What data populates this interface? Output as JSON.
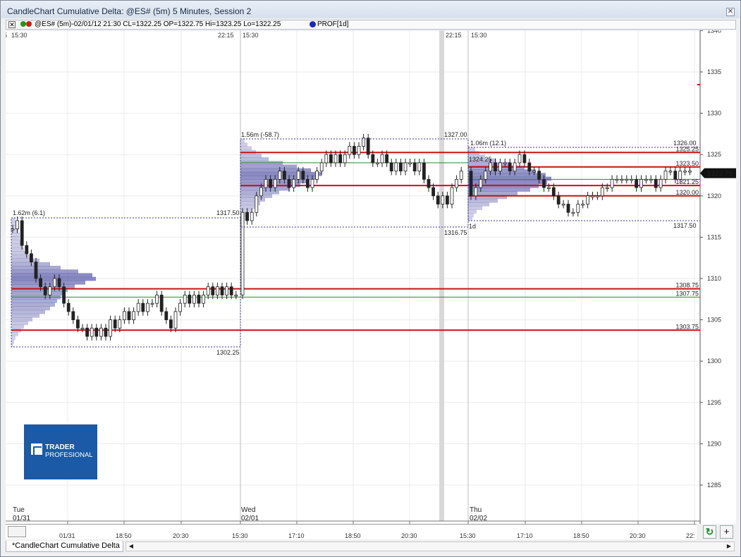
{
  "window": {
    "title": "CandleChart Cumulative Delta: @ES# (5m) 5 Minutes, Session 2",
    "close_glyph": "✕"
  },
  "infobar": {
    "text": "@ES# (5m)-02/01/12 21:30 CL=1322.25 OP=1322.75 Hi=1323.25 Lo=1322.25",
    "study": "PROF[1d]",
    "close_glyph": "✕"
  },
  "price_axis": {
    "ticks": [
      "1340",
      "1335",
      "1330",
      "1325",
      "1320",
      "1315",
      "1310",
      "1305",
      "1300",
      "1295",
      "1290",
      "1285"
    ],
    "last_price": "1322.75",
    "last_price_color": "#cc0000"
  },
  "top_time_labels": [
    "5",
    "15:30",
    "22:15",
    "15:30",
    "22:15",
    "15:30"
  ],
  "time_axis": {
    "ticks": [
      "01/31",
      "18:50",
      "20:30",
      "15:30",
      "17:10",
      "18:50",
      "20:30",
      "15:30",
      "17:10",
      "18:50",
      "20:30",
      "22:"
    ]
  },
  "day_labels": [
    {
      "day": "Tue",
      "date": "01/31"
    },
    {
      "day": "Wed",
      "date": "02/01"
    },
    {
      "day": "Thu",
      "date": "02/02"
    }
  ],
  "profiles": [
    {
      "volume_label": "1.62m (6.1)",
      "high": "1317.50",
      "low": "1302.25"
    },
    {
      "volume_label": "1.56m (-58.7)",
      "high": "1327.00",
      "low": "1316.75"
    },
    {
      "volume_label": "1.06m (12.1)",
      "high": "1326.00",
      "low": "1317.50",
      "period": "1d",
      "poc_label": "1324.25"
    }
  ],
  "level_labels": [
    "1325.25",
    "1323.50",
    "1321.25",
    "1320.00",
    "1308.75",
    "1307.75",
    "1303.75"
  ],
  "logo": {
    "line1": "TRADER",
    "line2": "PROFESIONAL"
  },
  "tab": {
    "label": "*CandleChart Cumulative Delta"
  },
  "colors": {
    "red_level": "#cc1111",
    "green_level": "#2a8a2a",
    "profile": "#5a5aa8",
    "session_bar": "#d8d8d8"
  }
}
